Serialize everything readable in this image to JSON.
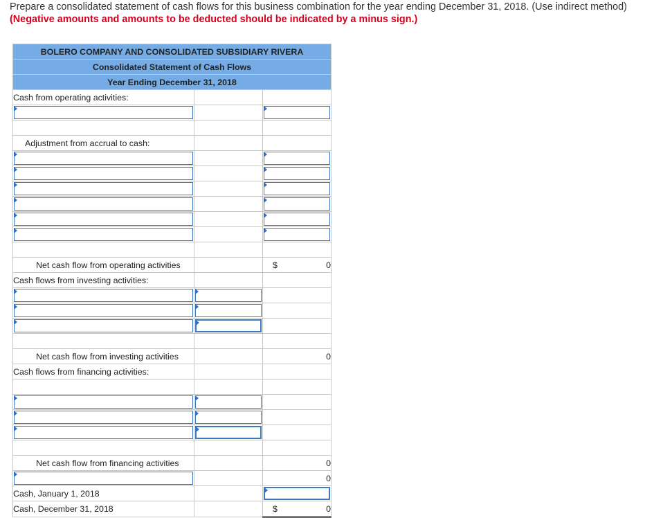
{
  "prompt": {
    "text": "Prepare a consolidated statement of cash flows for this business combination for the year ending December 31, 2018. (Use indirect method)",
    "emphasis": "(Negative amounts and amounts to be deducted should be indicated by a minus sign.)"
  },
  "statement": {
    "company": "BOLERO COMPANY AND CONSOLIDATED SUBSIDIARY RIVERA",
    "title": "Consolidated Statement of Cash Flows",
    "period": "Year Ending December 31, 2018",
    "operating_header": "Cash from operating activities:",
    "adjustment_header": "Adjustment from accrual to cash:",
    "net_operating_label": "Net cash flow from operating activities",
    "net_operating_currency": "$",
    "net_operating_value": "0",
    "investing_header": "Cash flows from investing activities:",
    "net_investing_label": "Net cash flow from investing activities",
    "net_investing_value": "0",
    "financing_header": "Cash flows from financing activities:",
    "net_financing_label": "Net cash flow from financing activities",
    "net_financing_value": "0",
    "change_value": "0",
    "cash_begin_label": "Cash, January 1, 2018",
    "cash_end_label": "Cash, December 31, 2018",
    "cash_end_currency": "$",
    "cash_end_value": "0"
  },
  "colors": {
    "header_bg": "#76ace6",
    "input_border": "#3d78c4",
    "emphasis": "#d6001c"
  }
}
